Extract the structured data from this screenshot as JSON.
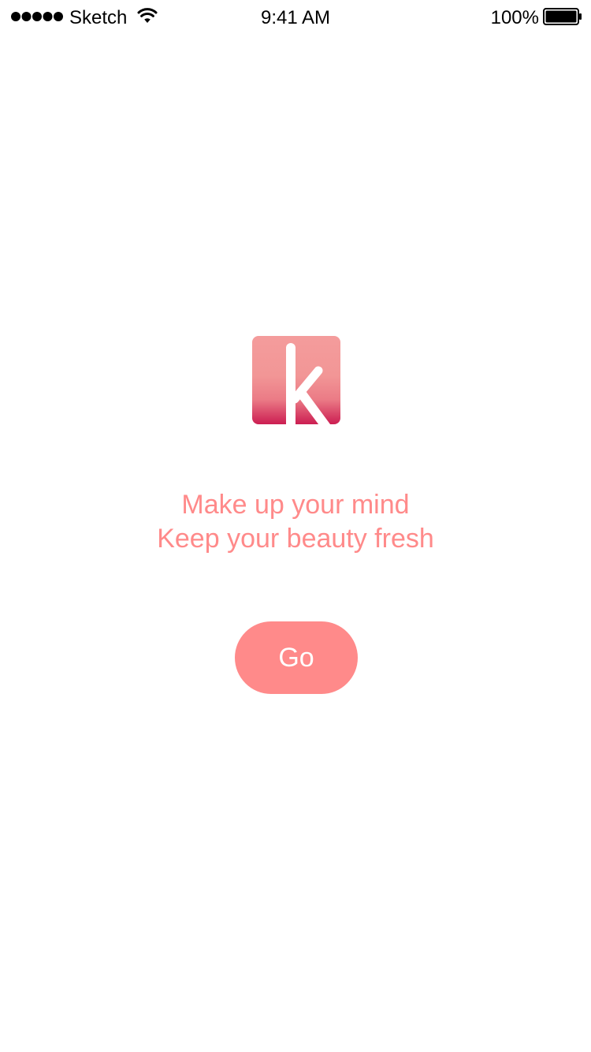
{
  "status_bar": {
    "carrier": "Sketch",
    "time": "9:41 AM",
    "battery_percent": "100%",
    "battery_level": 1.0,
    "signal_bars": 5,
    "icons": [
      "signal-dots-icon",
      "wifi-icon",
      "battery-icon"
    ]
  },
  "splash": {
    "logo_letter": "k",
    "tagline_line1": "Make up your mind",
    "tagline_line2": "Keep your beauty fresh",
    "go_label": "Go"
  },
  "colors": {
    "accent": "#FF8A8A",
    "logo_gradient_top": "#F49C9C",
    "logo_gradient_mid": "#EE8A8F",
    "logo_gradient_bottom": "#CC1E52",
    "background": "#FFFFFF",
    "status_text": "#000000"
  }
}
